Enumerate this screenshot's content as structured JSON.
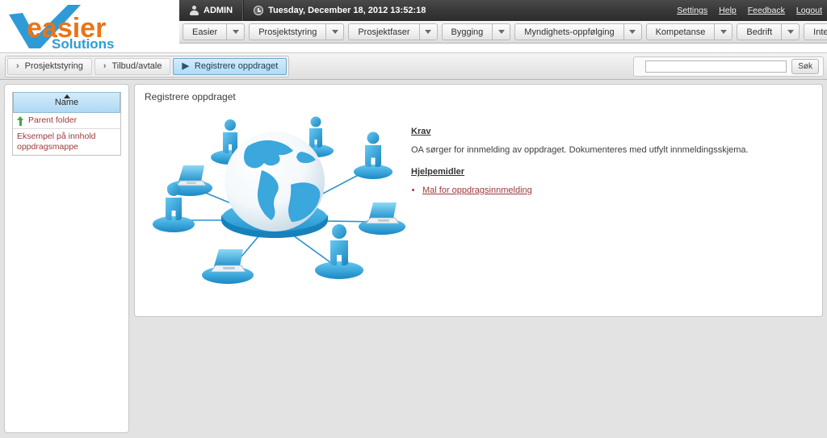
{
  "brand": {
    "name_primary": "easier",
    "name_secondary": "Solutions",
    "color_primary": "#E8751A",
    "color_secondary": "#2E9BD6"
  },
  "adminbar": {
    "user_icon": "person-icon",
    "user": "ADMIN",
    "clock_icon": "clock-icon",
    "datetime": "Tuesday, December 18, 2012 13:52:18",
    "links": [
      {
        "label": "Settings"
      },
      {
        "label": "Help"
      },
      {
        "label": "Feedback"
      },
      {
        "label": "Logout"
      }
    ]
  },
  "menubar": {
    "items": [
      {
        "label": "Easier"
      },
      {
        "label": "Prosjektstyring"
      },
      {
        "label": "Prosjektfaser"
      },
      {
        "label": "Bygging"
      },
      {
        "label": "Myndighets-oppfølging"
      },
      {
        "label": "Kompetanse"
      },
      {
        "label": "Bedrift"
      },
      {
        "label": "Internt"
      }
    ]
  },
  "breadcrumb": {
    "items": [
      {
        "label": "Prosjektstyring",
        "active": false,
        "arrow": "›"
      },
      {
        "label": "Tilbud/avtale",
        "active": false,
        "arrow": "›"
      },
      {
        "label": "Registrere oppdraget",
        "active": true,
        "arrow": "▶"
      }
    ]
  },
  "search": {
    "value": "",
    "placeholder": "",
    "button_label": "Søk",
    "icon": "search-icon"
  },
  "sidebar": {
    "table": {
      "header": "Name",
      "sort_icon": "sort-ascending-icon",
      "rows": [
        {
          "icon": "green-up-arrow-icon",
          "label": "Parent folder"
        },
        {
          "icon": "",
          "label": "Eksempel på innhold oppdragsmappe"
        }
      ]
    }
  },
  "main": {
    "title": "Registrere oppdraget",
    "illustration": "global-network-people-laptops-globe-illustration",
    "sections": [
      {
        "heading": "Krav",
        "paragraph": "OA sørger for innmelding av oppdraget. Dokumenteres med utfylt innmeldingsskjema."
      },
      {
        "heading": "Hjelpemidler",
        "links": [
          {
            "label": "Mal for oppdragsinnmelding"
          }
        ]
      }
    ]
  },
  "colors": {
    "page_background": "#e3e3e3",
    "admin_bar": "#363636",
    "accent_blue": "#aedcf6",
    "link_red": "#9b3a3a",
    "folder_green": "#4ba24b"
  }
}
